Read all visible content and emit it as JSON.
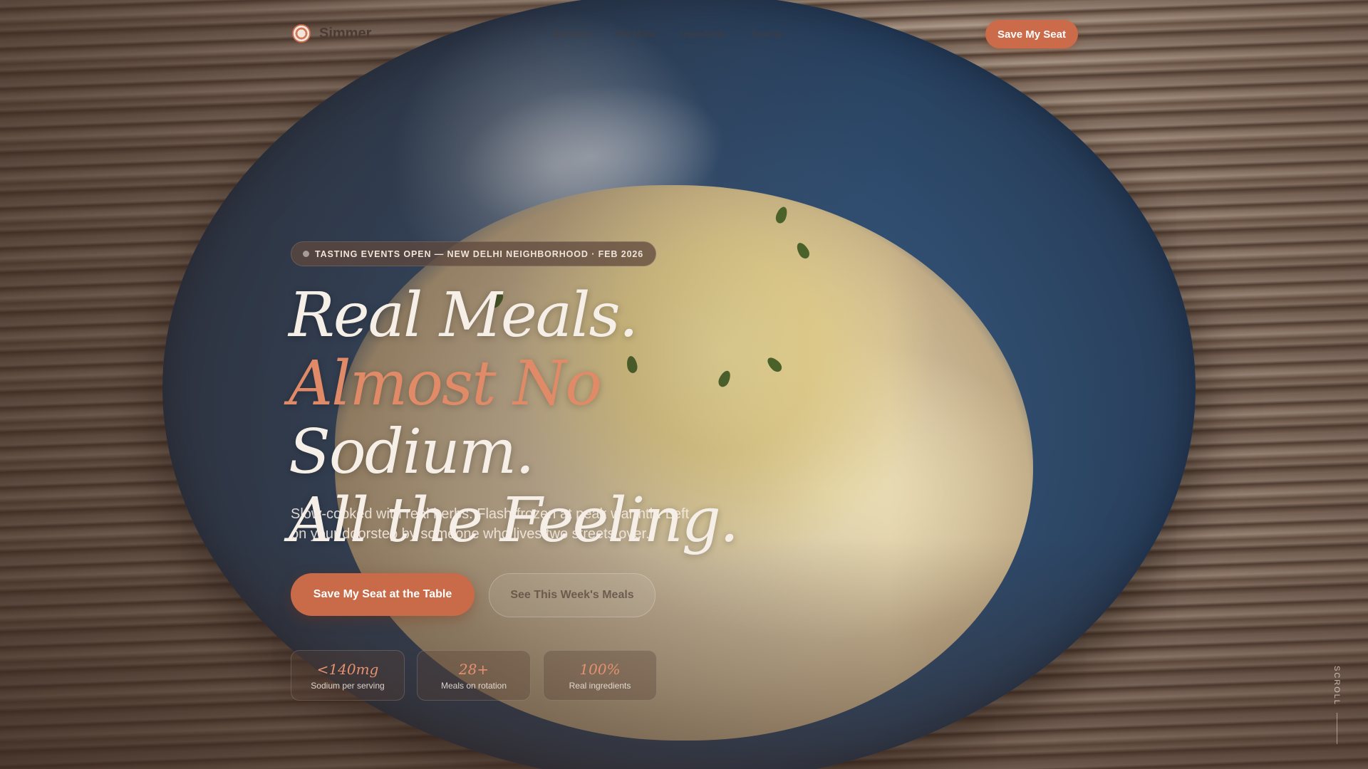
{
  "header": {
    "brand_name": "Simmer",
    "nav": [
      "Our story",
      "The Menu",
      "Ingredients",
      "Tastings"
    ],
    "cta_label": "Save My Seat"
  },
  "hero": {
    "badge": "TASTING EVENTS OPEN — NEW DELHI NEIGHBORHOOD · FEB 2026",
    "headline_part1": "Real Meals. ",
    "headline_accent": "Almost No",
    "headline_part2": " Sodium.",
    "headline_line3": "All the Feeling.",
    "subtext": "Slow-cooked with real herbs. Flash-frozen at peak warmth. Left on your doorstep by someone who lives two streets over.",
    "primary_cta": "Save My Seat at the Table",
    "secondary_cta": "See This Week's Meals"
  },
  "stats": [
    {
      "value": "<140mg",
      "label": "Sodium per serving"
    },
    {
      "value": "28+",
      "label": "Meals on rotation"
    },
    {
      "value": "100%",
      "label": "Real ingredients"
    }
  ],
  "scroll_label": "SCROLL",
  "colors": {
    "accent": "#cc6b4a",
    "accent_text": "#e08a67",
    "headline": "#f6efe8"
  }
}
